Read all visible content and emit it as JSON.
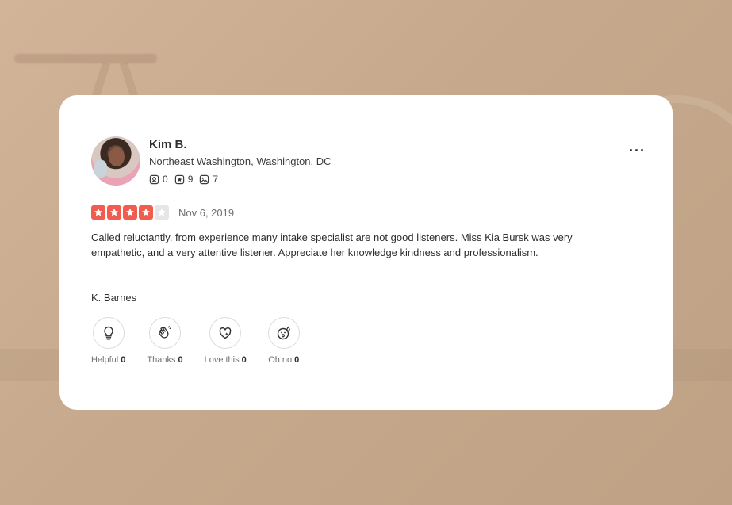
{
  "reviewer": {
    "name": "Kim B.",
    "location": "Northeast Washington, Washington, DC",
    "friends": "0",
    "reviews": "9",
    "photos": "7"
  },
  "rating": {
    "stars": 4,
    "max": 5,
    "date": "Nov 6, 2019"
  },
  "review": {
    "text": "Called reluctantly, from experience many intake specialist are not good listeners. Miss Kia Bursk was very empathetic, and a very attentive listener. Appreciate her knowledge kindness and professionalism.",
    "signature": "K. Barnes"
  },
  "menu": {
    "more_label": "···"
  },
  "reactions": [
    {
      "label": "Helpful",
      "count": "0",
      "icon": "lightbulb-icon"
    },
    {
      "label": "Thanks",
      "count": "0",
      "icon": "wave-hand-icon"
    },
    {
      "label": "Love this",
      "count": "0",
      "icon": "heart-sparkle-icon"
    },
    {
      "label": "Oh no",
      "count": "0",
      "icon": "surprised-face-icon"
    }
  ],
  "colors": {
    "star_on": "#f15c4f",
    "star_off": "#e6e6e6",
    "card_bg": "#ffffff",
    "page_bg": "#c9ac8f"
  }
}
